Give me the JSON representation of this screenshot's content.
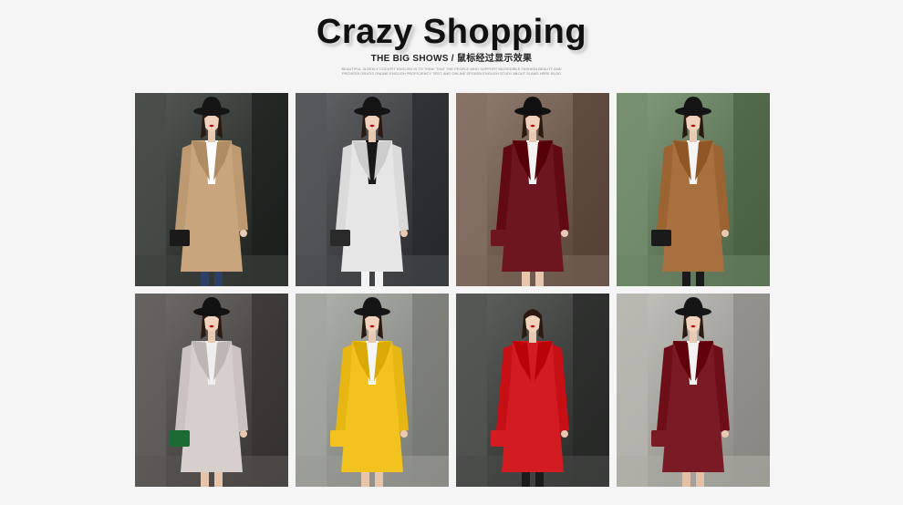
{
  "header": {
    "title": "Crazy Shopping",
    "subtitle": "THE BIG SHOWS / 鼠标经过显示效果",
    "tagline": "BEAUTIFUL SLEEKLY COCKPIT ENGLISH IS TO THINK THAT THE PEOPLE WHO SUPPORT INCREDIBLE FASHION BEAUTY AND PROVESS GRATIS ONLINE ENGLISH PROFICIENCY TEST, AND ONLINE SPOKEN ENGLISH STUDY ABOUT SLANG HERE BLOG"
  },
  "gallery": [
    {
      "name": "model-camel-coat-photo",
      "coat": "#c9a57e",
      "bg": "#2f3330",
      "hat": "#151515",
      "bag": "#1a1a1a",
      "under": "#ffffff",
      "legs": "#2e3f66"
    },
    {
      "name": "model-houndstooth-coat-photo",
      "coat": "#e6e6e6",
      "bg": "#3b3d40",
      "hat": "#141414",
      "bag": "#2a2a2a",
      "under": "#181818",
      "legs": "#f2f2f2"
    },
    {
      "name": "model-burgundy-coat-photo",
      "coat": "#6e1522",
      "bg": "#6b564b",
      "hat": "#111111",
      "bag": "#6e1522",
      "under": "#f3f3f3",
      "legs": "#e8c6ae"
    },
    {
      "name": "model-brown-coat-train-photo",
      "coat": "#a8703f",
      "bg": "#5d7456",
      "hat": "#141414",
      "bag": "#1a1a1a",
      "under": "#f5f5f5",
      "legs": "#1a1a1a"
    },
    {
      "name": "model-grey-coat-photo",
      "coat": "#d7cfcc",
      "bg": "#4a4644",
      "hat": "#121212",
      "bag": "#1c6b34",
      "under": "#efefef",
      "legs": "#e5c4ab"
    },
    {
      "name": "model-yellow-coat-photo",
      "coat": "#f2c21f",
      "bg": "#8a8c86",
      "hat": "#151515",
      "bag": "#f2c21f",
      "under": "#f5f5f5",
      "legs": "#e7c5ab"
    },
    {
      "name": "model-red-coat-photo",
      "coat": "#d21c22",
      "bg": "#3a3c3a",
      "hat": "none",
      "bag": "#d21c22",
      "under": "#d21c22",
      "legs": "#1b1b1b"
    },
    {
      "name": "model-wine-coat-photo",
      "coat": "#7a1a24",
      "bg": "#9d9c96",
      "hat": "#151515",
      "bag": "#7a1a24",
      "under": "#f3f3f3",
      "legs": "#e4c1a6"
    }
  ]
}
